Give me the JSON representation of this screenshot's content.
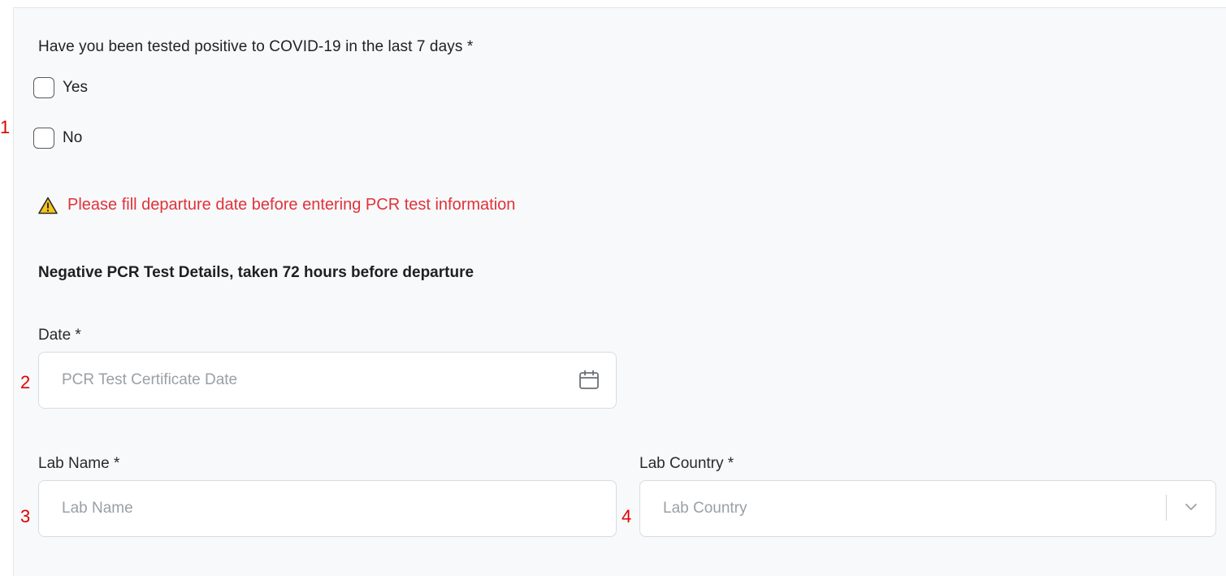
{
  "annotations": [
    "1",
    "2",
    "3",
    "4"
  ],
  "question": {
    "text": "Have you been tested positive to COVID-19 in the last 7 days *",
    "options": [
      {
        "label": "Yes",
        "checked": false
      },
      {
        "label": "No",
        "checked": false
      }
    ]
  },
  "warning": {
    "icon": "warning-triangle-icon",
    "text": "Please fill departure date before entering PCR test information",
    "color": "#e0323a"
  },
  "pcr": {
    "section_title": "Negative PCR Test Details, taken 72 hours before departure",
    "date": {
      "label": "Date *",
      "placeholder": "PCR Test Certificate Date",
      "icon": "calendar-icon"
    },
    "lab_name": {
      "label": "Lab Name *",
      "placeholder": "Lab Name"
    },
    "lab_country": {
      "label": "Lab Country *",
      "placeholder": "Lab Country",
      "icon": "chevron-down-icon"
    }
  }
}
